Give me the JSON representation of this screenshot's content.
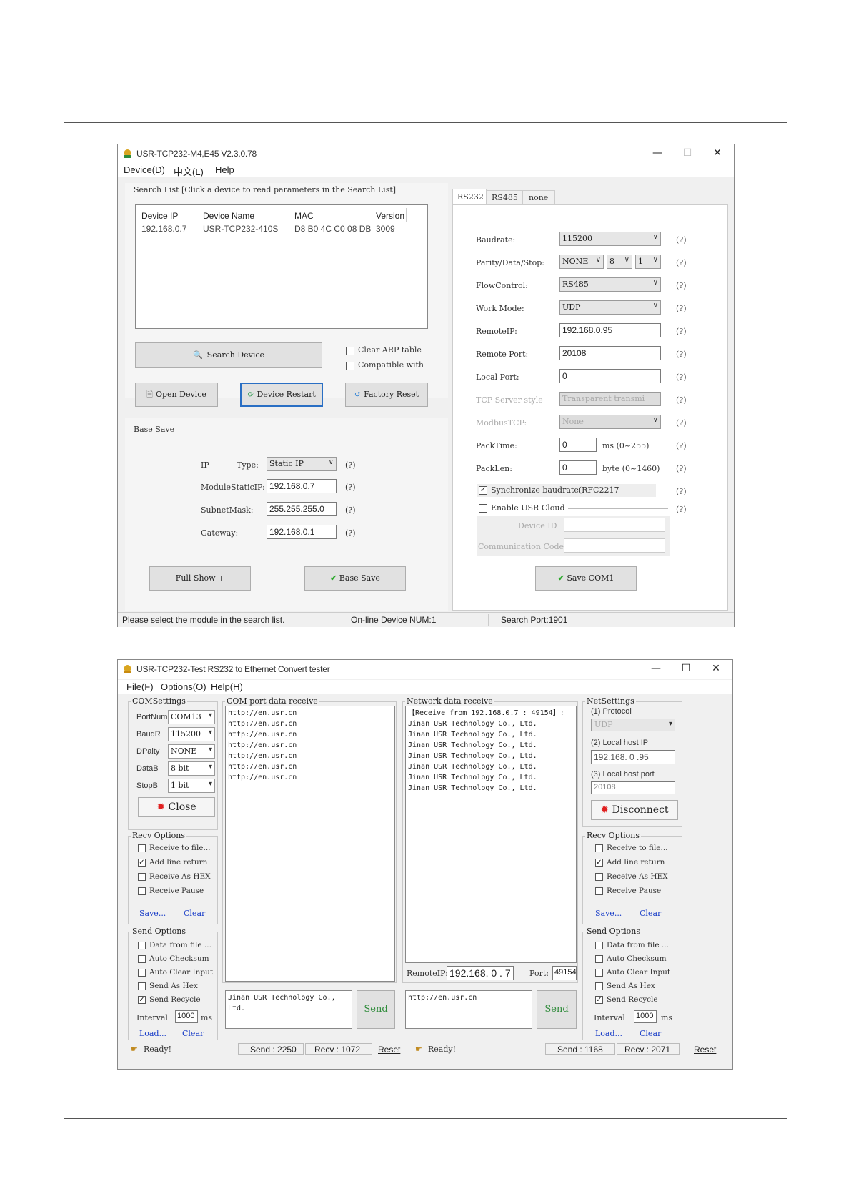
{
  "w1": {
    "title": "USR-TCP232-M4,E45 V2.3.0.78",
    "menu": [
      "Device(D)",
      "中文(L)",
      "Help"
    ],
    "search_list_title": "Search List [Click a device to read parameters in the Search List]",
    "columns": [
      "Device IP",
      "Device Name",
      "MAC",
      "Version"
    ],
    "row": [
      "192.168.0.7",
      "USR-TCP232-410S",
      "D8 B0 4C C0 08 DB",
      "3009"
    ],
    "search_btn": "Search Device",
    "clear_arp": "Clear ARP table",
    "compatible": "Compatible with",
    "open_btn": "Open Device",
    "restart_btn": "Device Restart",
    "factory_btn": "Factory Reset",
    "base_save_title": "Base Save",
    "ip_label": "IP",
    "type_label": "Type:",
    "type_value": "Static IP",
    "static_ip_label": "ModuleStaticIP:",
    "static_ip_value": "192.168.0.7",
    "subnet_label": "SubnetMask:",
    "subnet_value": "255.255.255.0",
    "gateway_label": "Gateway:",
    "gateway_value": "192.168.0.1",
    "q": "(?)",
    "full_show": "Full Show  +",
    "base_save_btn": "Base Save",
    "tabs": [
      "RS232",
      "RS485",
      "none"
    ],
    "baud_label": "Baudrate:",
    "baud_value": "115200",
    "pds_label": "Parity/Data/Stop:",
    "parity_value": "NONE",
    "data_value": "8",
    "stop_value": "1",
    "flow_label": "FlowControl:",
    "flow_value": "RS485",
    "work_label": "Work Mode:",
    "work_value": "UDP",
    "rip_label": "RemoteIP:",
    "rip_value": "192.168.0.95",
    "rport_label": "Remote Port:",
    "rport_value": "20108",
    "lport_label": "Local Port:",
    "lport_value": "0",
    "tcp_label": "TCP Server style",
    "tcp_value": "Transparent transmi",
    "modbus_label": "ModbusTCP:",
    "modbus_value": "None",
    "packtime_label": "PackTime:",
    "packtime_value": "0",
    "packtime_unit": "ms (0~255)",
    "packlen_label": "PackLen:",
    "packlen_value": "0",
    "packlen_unit": "byte (0~1460)",
    "sync_label": "Synchronize baudrate(RFC2217",
    "cloud_label": "Enable USR Cloud",
    "devid_label": "Device ID",
    "comm_label": "Communication Code",
    "save_com": "Save COM1",
    "status": [
      "Please select the module in the search list.",
      "On-line Device NUM:1",
      "Search Port:1901"
    ]
  },
  "w2": {
    "title": "USR-TCP232-Test  RS232 to Ethernet Convert tester",
    "menu": [
      "File(F)",
      "Options(O)",
      "Help(H)"
    ],
    "com_settings": "COMSettings",
    "portnum_label": "PortNum",
    "portnum_value": "COM13",
    "baud_label": "BaudR",
    "baud_value": "115200",
    "parity_label": "DPaity",
    "parity_value": "NONE",
    "datab_label": "DataB",
    "datab_value": "8 bit",
    "stopb_label": "StopB",
    "stopb_value": "1 bit",
    "close_btn": "Close",
    "com_recv_title": "COM port data receive",
    "com_recv_lines": "http://en.usr.cn\nhttp://en.usr.cn\nhttp://en.usr.cn\nhttp://en.usr.cn\nhttp://en.usr.cn\nhttp://en.usr.cn\nhttp://en.usr.cn",
    "net_recv_title": "Network data receive",
    "net_recv_lines": "【Receive from 192.168.0.7 : 49154】:\nJinan USR Technology Co., Ltd.\nJinan USR Technology Co., Ltd.\nJinan USR Technology Co., Ltd.\nJinan USR Technology Co., Ltd.\nJinan USR Technology Co., Ltd.\nJinan USR Technology Co., Ltd.\nJinan USR Technology Co., Ltd.",
    "net_settings": "NetSettings",
    "protocol_label": "(1) Protocol",
    "protocol_value": "UDP",
    "local_ip_label": "(2) Local host IP",
    "local_ip_value": "192.168. 0 .95",
    "local_port_label": "(3) Local host port",
    "local_port_value": "20108",
    "disconnect_btn": "Disconnect",
    "recv_options": "Recv Options",
    "recv_opts": [
      "Receive to file...",
      "Add line return",
      "Receive As HEX",
      "Receive Pause"
    ],
    "recv_checked": [
      false,
      true,
      false,
      false
    ],
    "save_link": "Save...",
    "clear_link": "Clear",
    "send_options": "Send Options",
    "send_opts": [
      "Data from file ...",
      "Auto Checksum",
      "Auto Clear Input",
      "Send As Hex",
      "Send Recycle"
    ],
    "send_checked": [
      false,
      false,
      false,
      false,
      true
    ],
    "interval_label": "Interval",
    "interval_value": "1000",
    "interval_unit": "ms",
    "load_link": "Load...",
    "com_send_text": "Jinan USR Technology Co.,\nLtd.",
    "send_btn": "Send",
    "remote_ip_label": "RemoteIP:",
    "remote_ip_value": "192.168. 0 . 7",
    "port_label": "Port:",
    "port_value": "49154",
    "net_send_text": "http://en.usr.cn",
    "ready": "Ready!",
    "com_send_count": "Send : 2250",
    "com_recv_count": "Recv : 1072",
    "reset": "Reset",
    "net_send_count": "Send : 1168",
    "net_recv_count": "Recv : 2071"
  }
}
